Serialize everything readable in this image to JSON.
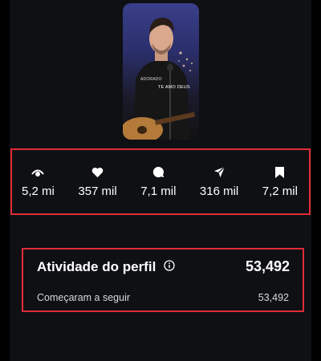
{
  "video": {
    "caption_small": "ADORADO",
    "caption": "TE AMO DEUS"
  },
  "stats": [
    {
      "icon": "eye-icon",
      "value": "5,2 mi"
    },
    {
      "icon": "heart-icon",
      "value": "357 mil"
    },
    {
      "icon": "comment-icon",
      "value": "7,1 mil"
    },
    {
      "icon": "share-icon",
      "value": "316 mil"
    },
    {
      "icon": "bookmark-icon",
      "value": "7,2 mil"
    }
  ],
  "profile_activity": {
    "title": "Atividade do perfil",
    "total": "53,492",
    "rows": [
      {
        "label": "Começaram a seguir",
        "value": "53,492"
      }
    ]
  },
  "colors": {
    "background": "#0e1014",
    "highlight_border": "#e12c36",
    "text": "#ffffff"
  }
}
